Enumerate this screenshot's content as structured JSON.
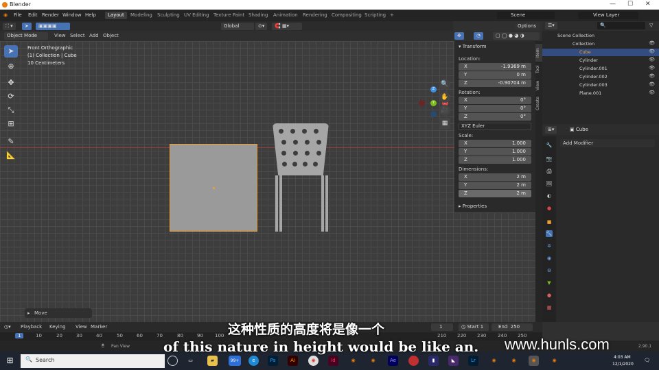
{
  "window": {
    "title": "Blender",
    "controls": [
      "—",
      "☐",
      "✕"
    ]
  },
  "menubar": {
    "items": [
      "File",
      "Edit",
      "Render",
      "Window",
      "Help"
    ],
    "workspaces": [
      "Layout",
      "Modeling",
      "Sculpting",
      "UV Editing",
      "Texture Paint",
      "Shading",
      "Animation",
      "Rendering",
      "Compositing",
      "Scripting"
    ],
    "active_workspace": "Layout",
    "add": "+",
    "scene": "Scene",
    "view_layer": "View Layer"
  },
  "toolheader": {
    "orientation": "Global",
    "options": "Options"
  },
  "header2": {
    "mode": "Object Mode",
    "menus": [
      "View",
      "Select",
      "Add",
      "Object"
    ]
  },
  "viewport": {
    "info_lines": [
      "Front Orthographic",
      "(1) Collection | Cube",
      "10 Centimeters"
    ],
    "last_op": "Move"
  },
  "npanel": {
    "section": "Transform",
    "location_label": "Location:",
    "location": [
      {
        "axis": "X",
        "value": "-1.9369 m"
      },
      {
        "axis": "Y",
        "value": "0 m"
      },
      {
        "axis": "Z",
        "value": "-0.90704 m"
      }
    ],
    "rotation_label": "Rotation:",
    "rotation": [
      {
        "axis": "X",
        "value": "0°"
      },
      {
        "axis": "Y",
        "value": "0°"
      },
      {
        "axis": "Z",
        "value": "0°"
      }
    ],
    "rotation_mode": "XYZ Euler",
    "scale_label": "Scale:",
    "scale": [
      {
        "axis": "X",
        "value": "1.000"
      },
      {
        "axis": "Y",
        "value": "1.000"
      },
      {
        "axis": "Z",
        "value": "1.000"
      }
    ],
    "dimensions_label": "Dimensions:",
    "dimensions": [
      {
        "axis": "X",
        "value": "2 m"
      },
      {
        "axis": "Y",
        "value": "2 m"
      },
      {
        "axis": "Z",
        "value": "2 m"
      }
    ],
    "properties": "Properties"
  },
  "ntabs": [
    "Item",
    "Tool",
    "View",
    "Create"
  ],
  "outliner": {
    "root": "Scene Collection",
    "collection": "Collection",
    "items": [
      "Cube",
      "Cylinder",
      "Cylinder.001",
      "Cylinder.002",
      "Cylinder.003",
      "Plane.001"
    ],
    "selected": "Cube"
  },
  "properties": {
    "object": "Cube",
    "add_modifier": "Add Modifier"
  },
  "timeline": {
    "menus": [
      "Playback",
      "Keying",
      "View",
      "Marker"
    ],
    "current_frame": "1",
    "start_label": "Start",
    "start": "1",
    "end_label": "End",
    "end": "250"
  },
  "ruler": {
    "ticks": [
      "1",
      "10",
      "20",
      "30",
      "40",
      "50",
      "60",
      "70",
      "80",
      "90",
      "100",
      "210",
      "220",
      "230",
      "240",
      "250"
    ]
  },
  "statusbar": {
    "pan": "Pan View",
    "version": "2.90.1"
  },
  "taskbar": {
    "search": "Search",
    "time": "4:03 AM",
    "date": "12/1/2020",
    "badge": "99+"
  },
  "subtitles": {
    "chinese": "这种性质的高度将是像一个",
    "english": "of this nature in height would be like an."
  },
  "watermark": "www.hunls.com",
  "colors": {
    "accent": "#4772b3",
    "selection": "#f0a030",
    "x_axis": "#e04545",
    "y_axis": "#7cbd1f",
    "z_axis": "#3f8fe0"
  }
}
